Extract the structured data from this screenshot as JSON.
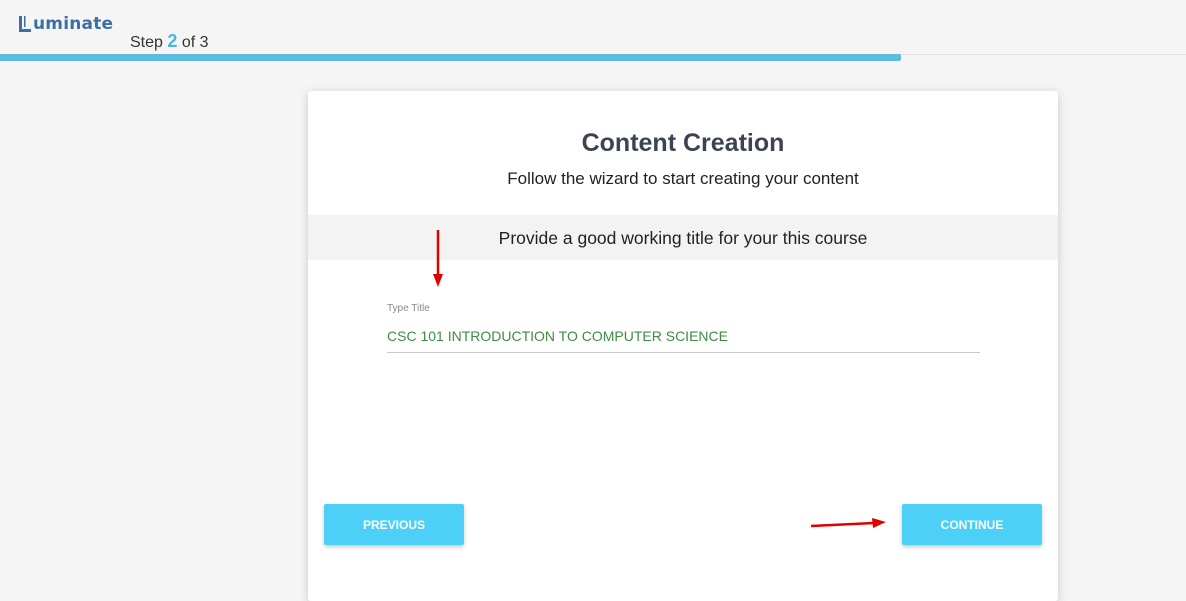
{
  "header": {
    "logo_text": "Luminate",
    "step_prefix": "Step",
    "step_current": "2",
    "step_suffix": "of 3",
    "progress_fraction": 0.76
  },
  "card": {
    "title": "Content Creation",
    "subtitle": "Follow the wizard to start creating your content",
    "prompt": "Provide a good working title for your this course",
    "field_label": "Type Title",
    "field_value": "CSC 101 INTRODUCTION TO COMPUTER SCIENCE",
    "previous_label": "PREVIOUS",
    "continue_label": "CONTINUE"
  },
  "colors": {
    "accent": "#4dd0f7",
    "progress": "#5bbcdf",
    "input_text": "#3e8e41",
    "annotation_arrow": "#e00000"
  }
}
